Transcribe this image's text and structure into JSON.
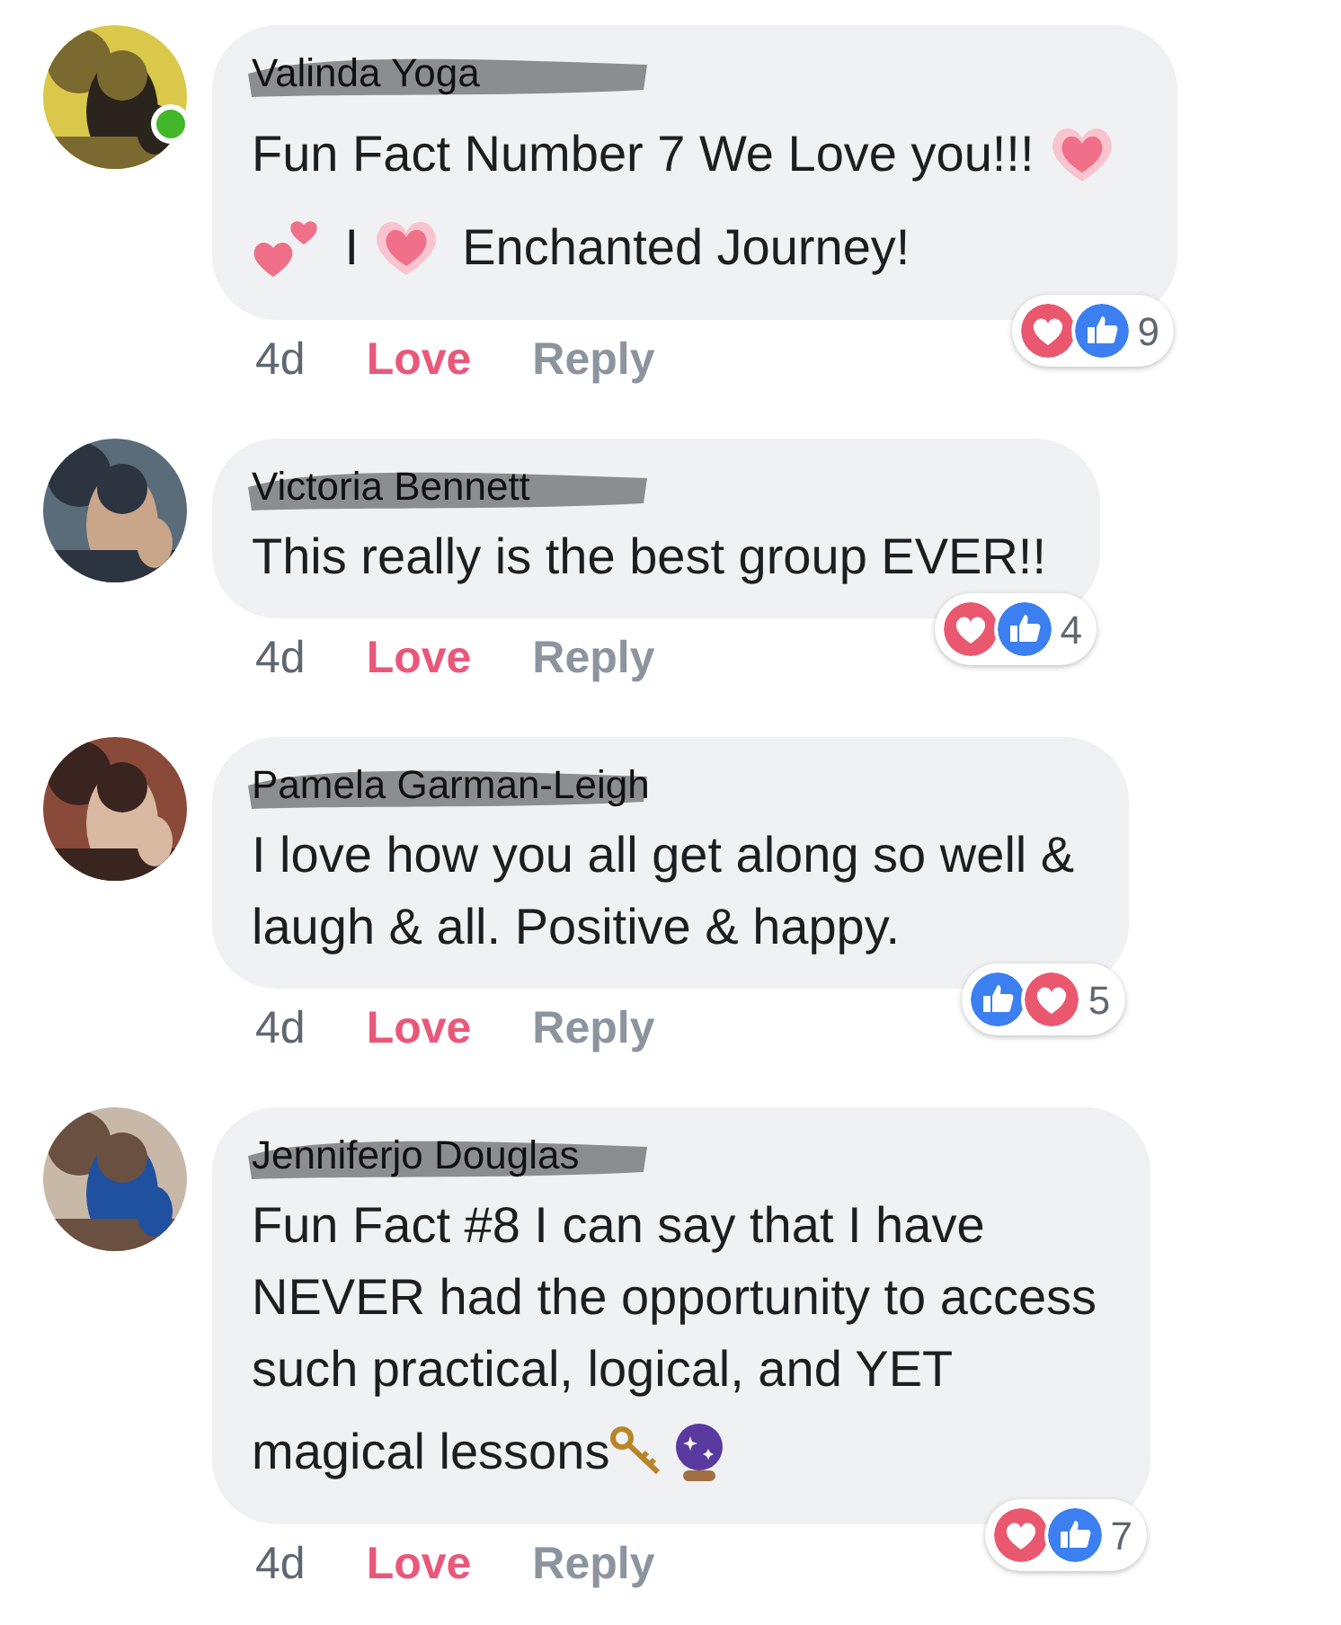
{
  "comments": [
    {
      "author": "Valinda Yoga",
      "online": true,
      "lines": [
        [
          {
            "kind": "text",
            "text": "Fun Fact Number 7 We Love you!!! "
          },
          {
            "kind": "glowing-heart"
          }
        ],
        [
          {
            "kind": "two-hearts"
          },
          {
            "kind": "text",
            "text": " I "
          },
          {
            "kind": "glowing-heart"
          },
          {
            "kind": "text",
            "text": " Enchanted Journey!"
          }
        ]
      ],
      "time": "4d",
      "love_label": "Love",
      "reacted": true,
      "reply_label": "Reply",
      "reactions": [
        {
          "kind": "love"
        },
        {
          "kind": "like"
        }
      ],
      "reaction_count": "9"
    },
    {
      "author": "Victoria Bennett",
      "online": false,
      "lines": [
        [
          {
            "kind": "text",
            "text": "This really is the best group EVER!!"
          }
        ]
      ],
      "time": "4d",
      "love_label": "Love",
      "reacted": true,
      "reply_label": "Reply",
      "reactions": [
        {
          "kind": "love"
        },
        {
          "kind": "like"
        }
      ],
      "reaction_count": "4"
    },
    {
      "author": "Pamela Garman-Leigh",
      "online": false,
      "lines": [
        [
          {
            "kind": "text",
            "text": "I love how you all get along so well &"
          }
        ],
        [
          {
            "kind": "text",
            "text": "laugh & all. Positive & happy."
          }
        ]
      ],
      "time": "4d",
      "love_label": "Love",
      "reacted": true,
      "reply_label": "Reply",
      "reactions": [
        {
          "kind": "like"
        },
        {
          "kind": "love"
        }
      ],
      "reaction_count": "5"
    },
    {
      "author": "Jenniferjo Douglas",
      "online": false,
      "lines": [
        [
          {
            "kind": "text",
            "text": "Fun Fact #8 I can say that I have"
          }
        ],
        [
          {
            "kind": "text",
            "text": "NEVER had the opportunity to access"
          }
        ],
        [
          {
            "kind": "text",
            "text": "such practical, logical, and YET"
          }
        ],
        [
          {
            "kind": "text",
            "text": "magical lessons"
          },
          {
            "kind": "key"
          },
          {
            "kind": "crystal-ball"
          }
        ]
      ],
      "time": "4d",
      "love_label": "Love",
      "reacted": true,
      "reply_label": "Reply",
      "reactions": [
        {
          "kind": "love"
        },
        {
          "kind": "like"
        }
      ],
      "reaction_count": "7"
    }
  ]
}
